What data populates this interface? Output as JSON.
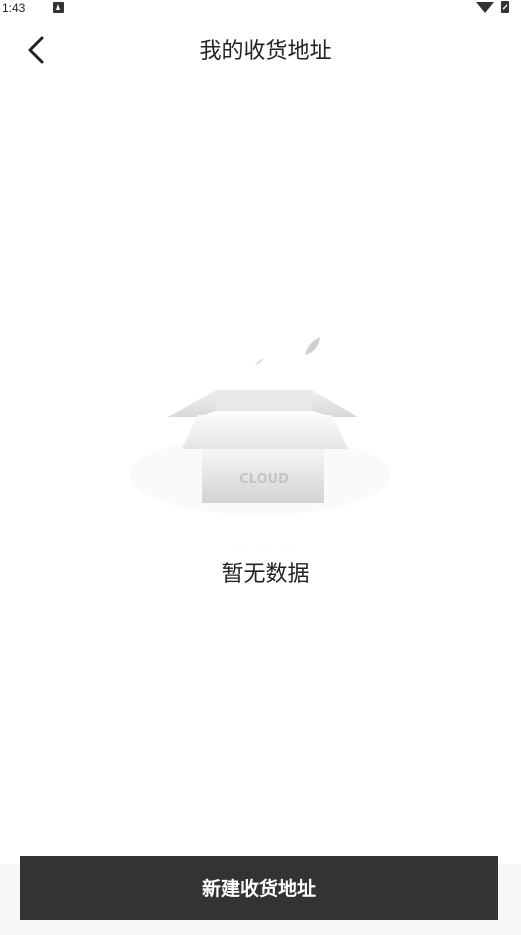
{
  "status_bar": {
    "time": "1:43",
    "notification_icon": "android-notification-icon",
    "wifi_icon": "wifi-icon",
    "battery_icon": "battery-charging-icon"
  },
  "header": {
    "back_icon": "chevron-left-icon",
    "title": "我的收货地址"
  },
  "empty_state": {
    "illustration_icon": "empty-box-icon",
    "box_label": "CLOUD",
    "text": "暂无数据"
  },
  "footer": {
    "new_address_label": "新建收货地址"
  },
  "colors": {
    "button_background": "#333333",
    "button_text": "#ffffff",
    "footer_background": "#f7f7f7",
    "text_primary": "#222222"
  }
}
